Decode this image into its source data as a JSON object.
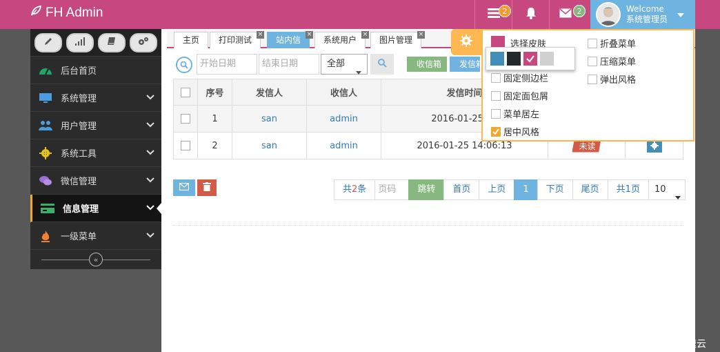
{
  "brand": {
    "title": "FH Admin"
  },
  "navbar": {
    "tasks_count": "2",
    "messages_count": "2",
    "welcome": "Welcome",
    "user_name": "系统管理员"
  },
  "sidebar": {
    "items": [
      {
        "label": "后台首页",
        "icon": "dashboard-icon",
        "color": "#22a56b"
      },
      {
        "label": "系统管理",
        "icon": "desktop-icon",
        "color": "#4b9de0"
      },
      {
        "label": "用户管理",
        "icon": "users-icon",
        "color": "#4b9de0"
      },
      {
        "label": "系统工具",
        "icon": "cog-icon",
        "color": "#e6c317"
      },
      {
        "label": "微信管理",
        "icon": "comments-icon",
        "color": "#9b6fd6"
      },
      {
        "label": "信息管理",
        "icon": "credit-card-icon",
        "color": "#3ab16a"
      },
      {
        "label": "一级菜单",
        "icon": "fire-icon",
        "color": "#f0822d"
      }
    ]
  },
  "tabs": [
    {
      "label": "主页",
      "closable": false
    },
    {
      "label": "打印测试",
      "closable": true
    },
    {
      "label": "站内信",
      "closable": true,
      "active": true
    },
    {
      "label": "系统用户",
      "closable": true
    },
    {
      "label": "图片管理",
      "closable": true
    }
  ],
  "toolbar": {
    "start_placeholder": "开始日期",
    "end_placeholder": "结束日期",
    "select_value": "全部",
    "inbox": "收信箱",
    "outbox": "发信箱"
  },
  "table": {
    "headers": [
      "序号",
      "发信人",
      "收信人",
      "发信时间"
    ],
    "rows": [
      {
        "no": "1",
        "from": "san",
        "to": "admin",
        "time": "2016-01-25 14"
      },
      {
        "no": "2",
        "from": "san",
        "to": "admin",
        "time": "2016-01-25 14:06:13",
        "status": "未读"
      }
    ]
  },
  "pager": {
    "total_prefix": "共",
    "total_count": "2",
    "total_suffix": "条",
    "page_placeholder": "页码",
    "jump": "跳转",
    "first": "首页",
    "prev": "上页",
    "current": "1",
    "next": "下页",
    "last": "尾页",
    "pages": "共1页",
    "size": "10"
  },
  "settings": {
    "skin_label": "选择皮肤",
    "fixed_sidebar": "固定侧边栏",
    "fixed_breadcrumb": "固定面包屑",
    "menu_left": "菜单居左",
    "center_style": "居中风格",
    "fold_menu": "折叠菜单",
    "compress_menu": "压缩菜单",
    "popup_style": "弹出风格"
  },
  "skins": [
    "#438eb9",
    "#222a2d",
    "#c6487e",
    "#d0d0d0"
  ],
  "watermark": "亿速云",
  "colors": {
    "navbar": "#c6487e",
    "accent": "#6fb3e0",
    "sidebar": "#222222",
    "success": "#87b87f",
    "danger": "#d15b47",
    "warning": "#ffb752"
  }
}
